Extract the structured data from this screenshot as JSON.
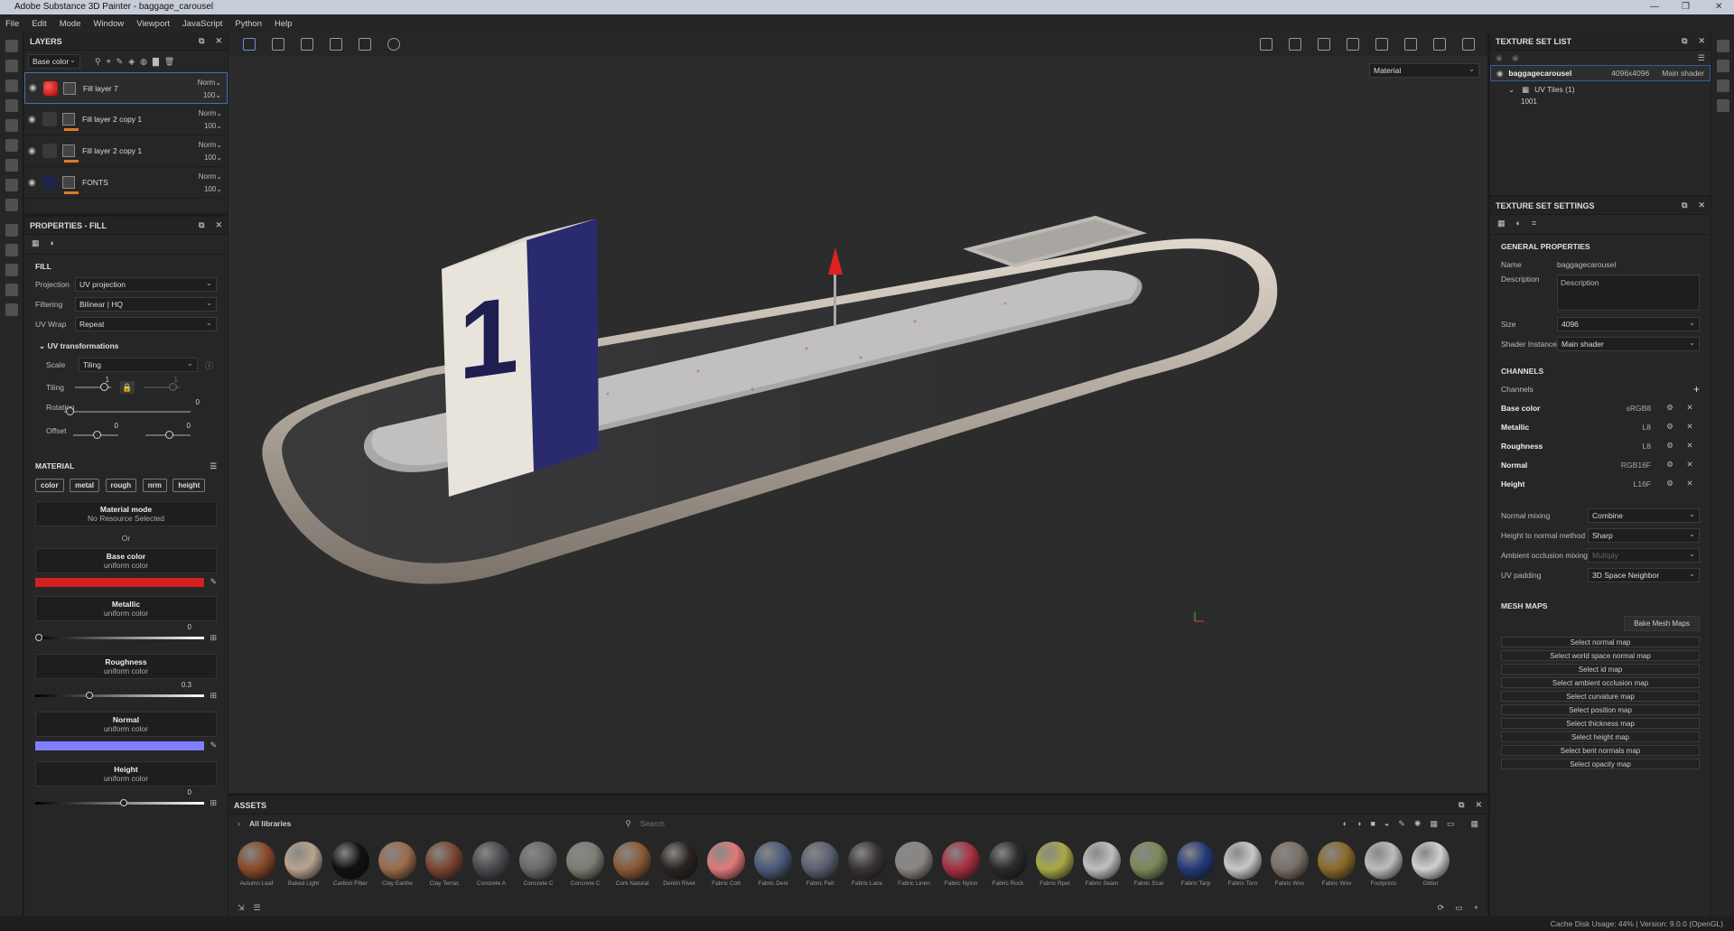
{
  "window": {
    "title": "Adobe Substance 3D Painter - baggage_carousel"
  },
  "menu": [
    "File",
    "Edit",
    "Mode",
    "Window",
    "Viewport",
    "JavaScript",
    "Python",
    "Help"
  ],
  "layers": {
    "title": "LAYERS",
    "channel": "Base color",
    "items": [
      {
        "name": "Fill layer 7",
        "blend": "Norm",
        "opacity": "100"
      },
      {
        "name": "Fill layer 2 copy 1",
        "blend": "Norm",
        "opacity": "100"
      },
      {
        "name": "Fill layer 2 copy 1",
        "blend": "Norm",
        "opacity": "100"
      },
      {
        "name": "FONTS",
        "blend": "Norm",
        "opacity": "100"
      }
    ]
  },
  "props": {
    "title": "PROPERTIES - FILL",
    "fill": "FILL",
    "projection_label": "Projection",
    "projection": "UV projection",
    "filtering_label": "Filtering",
    "filtering": "Bilinear | HQ",
    "uvwrap_label": "UV Wrap",
    "uvwrap": "Repeat",
    "uvt": "UV transformations",
    "scale_label": "Scale",
    "scale": "Tiling",
    "tiling_label": "Tiling",
    "tiling_value": "1",
    "tiling_value2": "1",
    "rotation_label": "Rotation",
    "rotation_value": "0",
    "offset_label": "Offset",
    "offset_x": "0",
    "offset_y": "0",
    "material": "MATERIAL",
    "chips": [
      "color",
      "metal",
      "rough",
      "nrm",
      "height"
    ],
    "mode_label": "Material mode",
    "mode_value": "No Resource Selected",
    "or": "Or",
    "base_label": "Base color",
    "base_sub": "uniform color",
    "base_color": "#d42020",
    "metal_label": "Metallic",
    "metal_sub": "uniform color",
    "metal_value": "0",
    "rough_label": "Roughness",
    "rough_sub": "uniform color",
    "rough_value": "0.3",
    "normal_label": "Normal",
    "normal_sub": "uniform color",
    "normal_color": "#7f7fff",
    "height_label": "Height",
    "height_sub": "uniform color",
    "height_value": "0"
  },
  "viewport": {
    "mode": "Material"
  },
  "assets": {
    "title": "ASSETS",
    "libs": "All libraries",
    "search_placeholder": "Search",
    "items": [
      {
        "name": "Autumn Leaf",
        "color": "#8a4a2a"
      },
      {
        "name": "Baked Light",
        "color": "#b9a48e"
      },
      {
        "name": "Carbon Fiber",
        "color": "#111111"
      },
      {
        "name": "Clay Earthe",
        "color": "#9a6b4a"
      },
      {
        "name": "Clay Terrac",
        "color": "#7a4530"
      },
      {
        "name": "Concrete A",
        "color": "#4a4a4e"
      },
      {
        "name": "Concrete C",
        "color": "#6a6a6a"
      },
      {
        "name": "Concrete C",
        "color": "#7d7d74"
      },
      {
        "name": "Cork Natural",
        "color": "#8a5a35"
      },
      {
        "name": "Denim Rivet",
        "color": "#2a2420"
      },
      {
        "name": "Fabric Cott",
        "color": "#e07a7a"
      },
      {
        "name": "Fabric Deni",
        "color": "#4a5a78"
      },
      {
        "name": "Fabric Felt",
        "color": "#5a6070"
      },
      {
        "name": "Fabric Lace",
        "color": "#3a3434"
      },
      {
        "name": "Fabric Linen",
        "color": "#8a8684"
      },
      {
        "name": "Fabric Nylon",
        "color": "#a83040"
      },
      {
        "name": "Fabric Ruck",
        "color": "#2a2a2a"
      },
      {
        "name": "Fabric Rpet",
        "color": "#a8a848"
      },
      {
        "name": "Fabric Seam",
        "color": "#c0c0c0"
      },
      {
        "name": "Fabric Scar",
        "color": "#7a8a5a"
      },
      {
        "name": "Fabric Tarp",
        "color": "#233a7a"
      },
      {
        "name": "Fabric Torn",
        "color": "#c8c8c8"
      },
      {
        "name": "Fabric Wov",
        "color": "#7a7068"
      },
      {
        "name": "Fabric Wov",
        "color": "#8a6a28"
      },
      {
        "name": "Footprints",
        "color": "#bdbdbd"
      },
      {
        "name": "Glitter",
        "color": "#d0d0d0"
      }
    ]
  },
  "tslist": {
    "title": "TEXTURE SET LIST",
    "name": "baggagecarousel",
    "size": "4096x4096",
    "shader": "Main shader",
    "uvtiles": "UV Tiles (1)",
    "tile": "1001"
  },
  "tss": {
    "title": "TEXTURE SET SETTINGS",
    "general": "GENERAL PROPERTIES",
    "name_label": "Name",
    "name_value": "baggagecarousel",
    "desc_label": "Description",
    "desc_value": "Description",
    "size_label": "Size",
    "size_value": "4096",
    "shader_label": "Shader Instance",
    "shader_value": "Main shader",
    "channels": "CHANNELS",
    "channels_label": "Channels",
    "chlist": [
      {
        "name": "Base color",
        "fmt": "sRGB8"
      },
      {
        "name": "Metallic",
        "fmt": "L8"
      },
      {
        "name": "Roughness",
        "fmt": "L8"
      },
      {
        "name": "Normal",
        "fmt": "RGB16F"
      },
      {
        "name": "Height",
        "fmt": "L16F"
      }
    ],
    "nm_label": "Normal mixing",
    "nm_value": "Combine",
    "hn_label": "Height to normal method",
    "hn_value": "Sharp",
    "ao_label": "Ambient occlusion mixing",
    "ao_value": "Multiply",
    "uvp_label": "UV padding",
    "uvp_value": "3D Space Neighbor",
    "meshmaps": "MESH MAPS",
    "bake": "Bake Mesh Maps",
    "maps": [
      "Select normal map",
      "Select world space normal map",
      "Select id map",
      "Select ambient occlusion map",
      "Select curvature map",
      "Select position map",
      "Select thickness map",
      "Select height map",
      "Select bent normals map",
      "Select opacity map"
    ]
  },
  "status": {
    "text": "Cache Disk Usage:   44% | Version: 9.0.0 (OpenGL)"
  }
}
